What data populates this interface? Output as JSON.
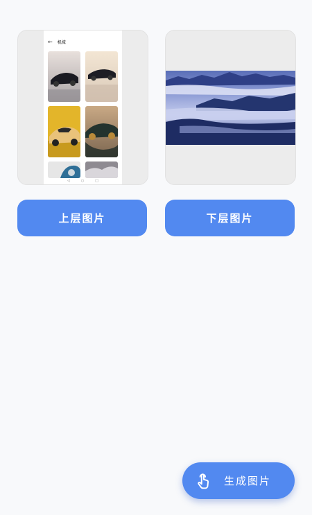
{
  "upper_card": {
    "phone": {
      "status_left": "",
      "status_right": "",
      "title": "机械",
      "back_icon": "arrow-left-icon"
    },
    "thumbnails": [
      "dark-hypercar",
      "dark-hypercar-2",
      "yellow-sports-car",
      "green-sports-car",
      "blue-car-partial",
      "cloud-scene-partial"
    ]
  },
  "lower_card": {
    "image": "misty-blue-mountain-landscape"
  },
  "buttons": {
    "upper_label": "上层图片",
    "lower_label": "下层图片"
  },
  "fab": {
    "label": "生成图片",
    "icon": "hand-tap-icon"
  }
}
